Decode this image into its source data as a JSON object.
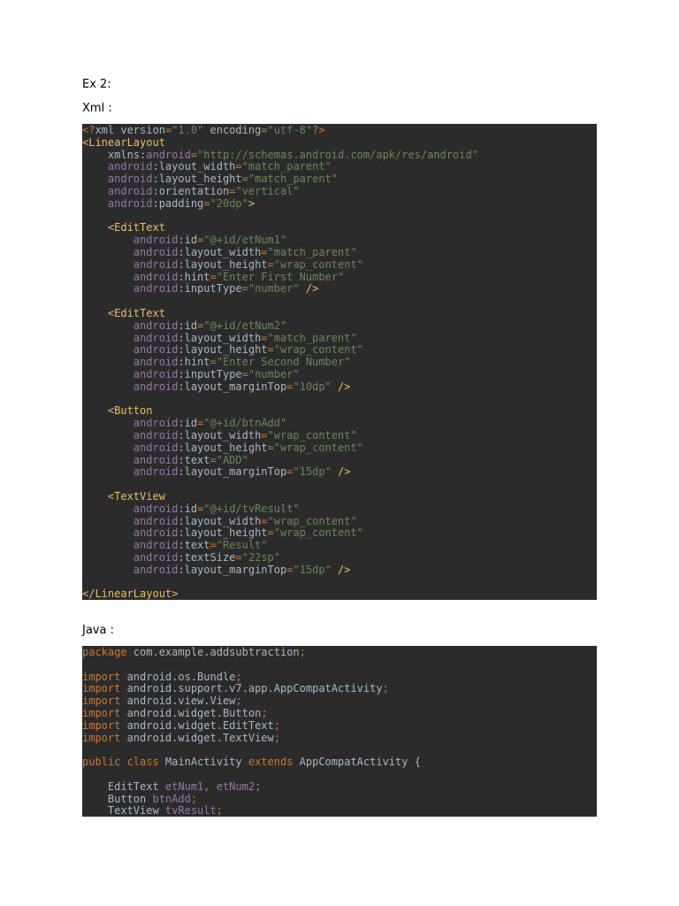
{
  "labels": {
    "ex": "Ex 2:",
    "xml": "Xml :",
    "java": "Java :"
  },
  "colors": {
    "code_background": "#2b2b2b",
    "keyword": "#cc7832",
    "tag": "#e8bf6a",
    "attribute_namespace": "#9876aa",
    "string": "#6a8759",
    "plain": "#a9b7c6"
  },
  "xml_code": [
    [
      [
        "kw",
        "<?"
      ],
      [
        "plain",
        "xml version"
      ],
      [
        "kw",
        "="
      ],
      [
        "str",
        "\"1.0\""
      ],
      [
        "plain",
        " encoding"
      ],
      [
        "kw",
        "="
      ],
      [
        "str",
        "\"utf-8\""
      ],
      [
        "kw",
        "?>"
      ]
    ],
    [
      [
        "tag",
        "<LinearLayout"
      ]
    ],
    [
      [
        "plain",
        "    xmlns:"
      ],
      [
        "attrns",
        "android"
      ],
      [
        "kw",
        "="
      ],
      [
        "str",
        "\"http://schemas.android.com/apk/res/android\""
      ]
    ],
    [
      [
        "attrns",
        "    android"
      ],
      [
        "plain",
        ":layout_width"
      ],
      [
        "kw",
        "="
      ],
      [
        "str",
        "\"match_parent\""
      ]
    ],
    [
      [
        "attrns",
        "    android"
      ],
      [
        "plain",
        ":layout_height"
      ],
      [
        "kw",
        "="
      ],
      [
        "str",
        "\"match_parent\""
      ]
    ],
    [
      [
        "attrns",
        "    android"
      ],
      [
        "plain",
        ":orientation"
      ],
      [
        "kw",
        "="
      ],
      [
        "str",
        "\"vertical\""
      ]
    ],
    [
      [
        "attrns",
        "    android"
      ],
      [
        "plain",
        ":padding"
      ],
      [
        "kw",
        "="
      ],
      [
        "str",
        "\"20dp\""
      ],
      [
        "tag",
        ">"
      ]
    ],
    [],
    [
      [
        "tag",
        "    <EditText"
      ]
    ],
    [
      [
        "attrns",
        "        android"
      ],
      [
        "plain",
        ":id"
      ],
      [
        "kw",
        "="
      ],
      [
        "str",
        "\"@+id/etNum1\""
      ]
    ],
    [
      [
        "attrns",
        "        android"
      ],
      [
        "plain",
        ":layout_width"
      ],
      [
        "kw",
        "="
      ],
      [
        "str",
        "\"match_parent\""
      ]
    ],
    [
      [
        "attrns",
        "        android"
      ],
      [
        "plain",
        ":layout_height"
      ],
      [
        "kw",
        "="
      ],
      [
        "str",
        "\"wrap_content\""
      ]
    ],
    [
      [
        "attrns",
        "        android"
      ],
      [
        "plain",
        ":hint"
      ],
      [
        "kw",
        "="
      ],
      [
        "str",
        "\"Enter First Number\""
      ]
    ],
    [
      [
        "attrns",
        "        android"
      ],
      [
        "plain",
        ":inputType"
      ],
      [
        "kw",
        "="
      ],
      [
        "str",
        "\"number\""
      ],
      [
        "tag",
        " />"
      ]
    ],
    [],
    [
      [
        "tag",
        "    <EditText"
      ]
    ],
    [
      [
        "attrns",
        "        android"
      ],
      [
        "plain",
        ":id"
      ],
      [
        "kw",
        "="
      ],
      [
        "str",
        "\"@+id/etNum2\""
      ]
    ],
    [
      [
        "attrns",
        "        android"
      ],
      [
        "plain",
        ":layout_width"
      ],
      [
        "kw",
        "="
      ],
      [
        "str",
        "\"match_parent\""
      ]
    ],
    [
      [
        "attrns",
        "        android"
      ],
      [
        "plain",
        ":layout_height"
      ],
      [
        "kw",
        "="
      ],
      [
        "str",
        "\"wrap_content\""
      ]
    ],
    [
      [
        "attrns",
        "        android"
      ],
      [
        "plain",
        ":hint"
      ],
      [
        "kw",
        "="
      ],
      [
        "str",
        "\"Enter Second Number\""
      ]
    ],
    [
      [
        "attrns",
        "        android"
      ],
      [
        "plain",
        ":inputType"
      ],
      [
        "kw",
        "="
      ],
      [
        "str",
        "\"number\""
      ]
    ],
    [
      [
        "attrns",
        "        android"
      ],
      [
        "plain",
        ":layout_marginTop"
      ],
      [
        "kw",
        "="
      ],
      [
        "str",
        "\"10dp\""
      ],
      [
        "tag",
        " />"
      ]
    ],
    [],
    [
      [
        "tag",
        "    <Button"
      ]
    ],
    [
      [
        "attrns",
        "        android"
      ],
      [
        "plain",
        ":id"
      ],
      [
        "kw",
        "="
      ],
      [
        "str",
        "\"@+id/btnAdd\""
      ]
    ],
    [
      [
        "attrns",
        "        android"
      ],
      [
        "plain",
        ":layout_width"
      ],
      [
        "kw",
        "="
      ],
      [
        "str",
        "\"wrap_content\""
      ]
    ],
    [
      [
        "attrns",
        "        android"
      ],
      [
        "plain",
        ":layout_height"
      ],
      [
        "kw",
        "="
      ],
      [
        "str",
        "\"wrap_content\""
      ]
    ],
    [
      [
        "attrns",
        "        android"
      ],
      [
        "plain",
        ":text"
      ],
      [
        "kw",
        "="
      ],
      [
        "str",
        "\"ADD\""
      ]
    ],
    [
      [
        "attrns",
        "        android"
      ],
      [
        "plain",
        ":layout_marginTop"
      ],
      [
        "kw",
        "="
      ],
      [
        "str",
        "\"15dp\""
      ],
      [
        "tag",
        " />"
      ]
    ],
    [],
    [
      [
        "tag",
        "    <TextView"
      ]
    ],
    [
      [
        "attrns",
        "        android"
      ],
      [
        "plain",
        ":id"
      ],
      [
        "kw",
        "="
      ],
      [
        "str",
        "\"@+id/tvResult\""
      ]
    ],
    [
      [
        "attrns",
        "        android"
      ],
      [
        "plain",
        ":layout_width"
      ],
      [
        "kw",
        "="
      ],
      [
        "str",
        "\"wrap_content\""
      ]
    ],
    [
      [
        "attrns",
        "        android"
      ],
      [
        "plain",
        ":layout_height"
      ],
      [
        "kw",
        "="
      ],
      [
        "str",
        "\"wrap_content\""
      ]
    ],
    [
      [
        "attrns",
        "        android"
      ],
      [
        "plain",
        ":text"
      ],
      [
        "kw",
        "="
      ],
      [
        "str",
        "\"Result\""
      ]
    ],
    [
      [
        "attrns",
        "        android"
      ],
      [
        "plain",
        ":textSize"
      ],
      [
        "kw",
        "="
      ],
      [
        "str",
        "\"22sp\""
      ]
    ],
    [
      [
        "attrns",
        "        android"
      ],
      [
        "plain",
        ":layout_marginTop"
      ],
      [
        "kw",
        "="
      ],
      [
        "str",
        "\"15dp\""
      ],
      [
        "tag",
        " />"
      ]
    ],
    [],
    [
      [
        "tag",
        "</LinearLayout>"
      ]
    ]
  ],
  "java_code": [
    [
      [
        "kw",
        "package"
      ],
      [
        "plain",
        " com.example.addsubtraction"
      ],
      [
        "kw",
        ";"
      ]
    ],
    [],
    [
      [
        "kw",
        "import"
      ],
      [
        "plain",
        " android.os.Bundle"
      ],
      [
        "kw",
        ";"
      ]
    ],
    [
      [
        "kw",
        "import"
      ],
      [
        "plain",
        " android.support.v7.app.AppCompatActivity"
      ],
      [
        "kw",
        ";"
      ]
    ],
    [
      [
        "kw",
        "import"
      ],
      [
        "plain",
        " android.view.View"
      ],
      [
        "kw",
        ";"
      ]
    ],
    [
      [
        "kw",
        "import"
      ],
      [
        "plain",
        " android.widget.Button"
      ],
      [
        "kw",
        ";"
      ]
    ],
    [
      [
        "kw",
        "import"
      ],
      [
        "plain",
        " android.widget.EditText"
      ],
      [
        "kw",
        ";"
      ]
    ],
    [
      [
        "kw",
        "import"
      ],
      [
        "plain",
        " android.widget.TextView"
      ],
      [
        "kw",
        ";"
      ]
    ],
    [],
    [
      [
        "kw",
        "public class"
      ],
      [
        "plain",
        " MainActivity "
      ],
      [
        "kw",
        "extends"
      ],
      [
        "plain",
        " AppCompatActivity {"
      ]
    ],
    [],
    [
      [
        "plain",
        "    EditText "
      ],
      [
        "field",
        "etNum1"
      ],
      [
        "kw",
        ", "
      ],
      [
        "field",
        "etNum2"
      ],
      [
        "kw",
        ";"
      ]
    ],
    [
      [
        "plain",
        "    Button "
      ],
      [
        "field",
        "btnAdd"
      ],
      [
        "kw",
        ";"
      ]
    ],
    [
      [
        "plain",
        "    TextView "
      ],
      [
        "field",
        "tvResult"
      ],
      [
        "kw",
        ";"
      ]
    ]
  ]
}
